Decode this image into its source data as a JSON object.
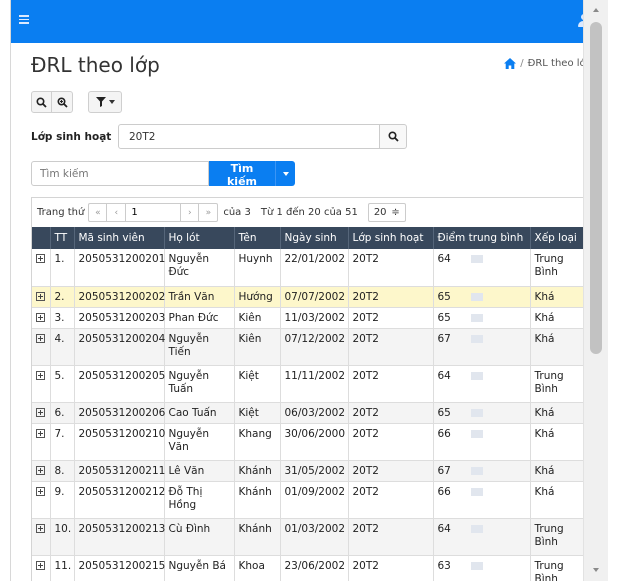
{
  "header": {
    "menu_icon": "hamburger-icon",
    "user_icon": "user-icon"
  },
  "page": {
    "title": "ĐRL theo lớp"
  },
  "breadcrumb": {
    "home_icon": "home-icon",
    "separator": "/",
    "current": "ĐRL theo lớp"
  },
  "toolbar": {
    "search_icon": "search-icon",
    "zoom_icon": "zoom-in-icon",
    "filter_icon": "filter-icon"
  },
  "class_filter": {
    "label": "Lớp sinh hoạt",
    "value": "20T2"
  },
  "keyword": {
    "placeholder": "Tìm kiếm",
    "button_label": "Tìm kiếm"
  },
  "pager": {
    "label": "Trang thứ",
    "first": "«",
    "prev": "‹",
    "next": "›",
    "last": "»",
    "page": "1",
    "of_pages": "của 3",
    "range_text": "Từ 1 đến 20 của 51",
    "page_size": "20",
    "page_size_arrow": "≑"
  },
  "table": {
    "columns": [
      "TT",
      "Mã sinh viên",
      "Họ lót",
      "Tên",
      "Ngày sinh",
      "Lớp sinh hoạt",
      "Điểm trung bình",
      "Xếp loại"
    ],
    "rows": [
      {
        "tt": "1.",
        "msv": "2050531200201",
        "holot": "Nguyễn Đức",
        "ten": "Huynh",
        "ngaysinh": "22/01/2002",
        "lop": "20T2",
        "diem": "64",
        "xeploai": "Trung Bình"
      },
      {
        "tt": "2.",
        "msv": "2050531200202",
        "holot": "Trần Văn",
        "ten": "Hướng",
        "ngaysinh": "07/07/2002",
        "lop": "20T2",
        "diem": "65",
        "xeploai": "Khá"
      },
      {
        "tt": "3.",
        "msv": "2050531200203",
        "holot": "Phan Đức",
        "ten": "Kiên",
        "ngaysinh": "11/03/2002",
        "lop": "20T2",
        "diem": "65",
        "xeploai": "Khá"
      },
      {
        "tt": "4.",
        "msv": "2050531200204",
        "holot": "Nguyễn Tiến",
        "ten": "Kiên",
        "ngaysinh": "07/12/2002",
        "lop": "20T2",
        "diem": "67",
        "xeploai": "Khá"
      },
      {
        "tt": "5.",
        "msv": "2050531200205",
        "holot": "Nguyễn Tuấn",
        "ten": "Kiệt",
        "ngaysinh": "11/11/2002",
        "lop": "20T2",
        "diem": "64",
        "xeploai": "Trung Bình"
      },
      {
        "tt": "6.",
        "msv": "2050531200206",
        "holot": "Cao Tuấn",
        "ten": "Kiệt",
        "ngaysinh": "06/03/2002",
        "lop": "20T2",
        "diem": "65",
        "xeploai": "Khá"
      },
      {
        "tt": "7.",
        "msv": "2050531200210",
        "holot": "Nguyễn Văn",
        "ten": "Khang",
        "ngaysinh": "30/06/2000",
        "lop": "20T2",
        "diem": "66",
        "xeploai": "Khá"
      },
      {
        "tt": "8.",
        "msv": "2050531200211",
        "holot": "Lê Văn",
        "ten": "Khánh",
        "ngaysinh": "31/05/2002",
        "lop": "20T2",
        "diem": "67",
        "xeploai": "Khá"
      },
      {
        "tt": "9.",
        "msv": "2050531200212",
        "holot": "Đỗ Thị Hồng",
        "ten": "Khánh",
        "ngaysinh": "01/09/2002",
        "lop": "20T2",
        "diem": "66",
        "xeploai": "Khá"
      },
      {
        "tt": "10.",
        "msv": "2050531200213",
        "holot": "Cù Đình",
        "ten": "Khánh",
        "ngaysinh": "01/03/2002",
        "lop": "20T2",
        "diem": "64",
        "xeploai": "Trung Bình"
      },
      {
        "tt": "11.",
        "msv": "2050531200215",
        "holot": "Nguyễn Bá",
        "ten": "Khoa",
        "ngaysinh": "23/06/2002",
        "lop": "20T2",
        "diem": "63",
        "xeploai": "Trung Bình"
      }
    ]
  },
  "colors": {
    "primary": "#0a7ef1",
    "table_header": "#38485c",
    "selected_row": "#fdf7cb",
    "alt_row": "#f4f4f4"
  }
}
